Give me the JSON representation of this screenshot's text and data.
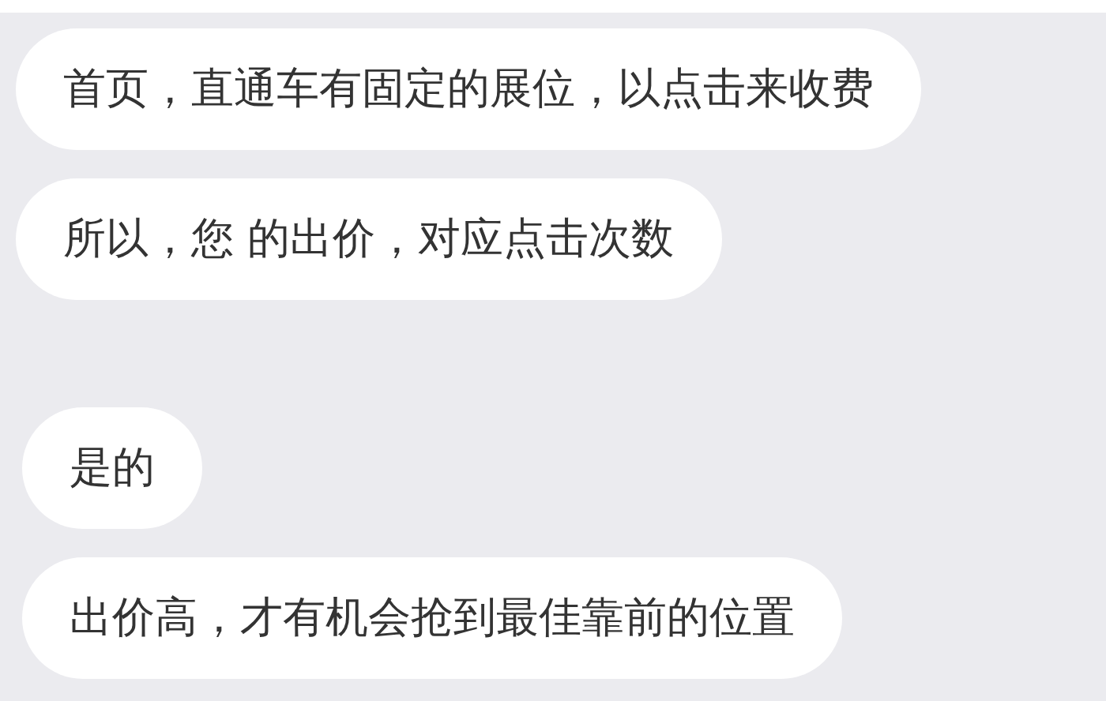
{
  "messages": [
    {
      "text": "首页，直通车有固定的展位，以点击来收费"
    },
    {
      "text": "所以，您 的出价，对应点击次数"
    },
    {
      "text": "是的"
    },
    {
      "text": "出价高，才有机会抢到最佳靠前的位置"
    }
  ]
}
